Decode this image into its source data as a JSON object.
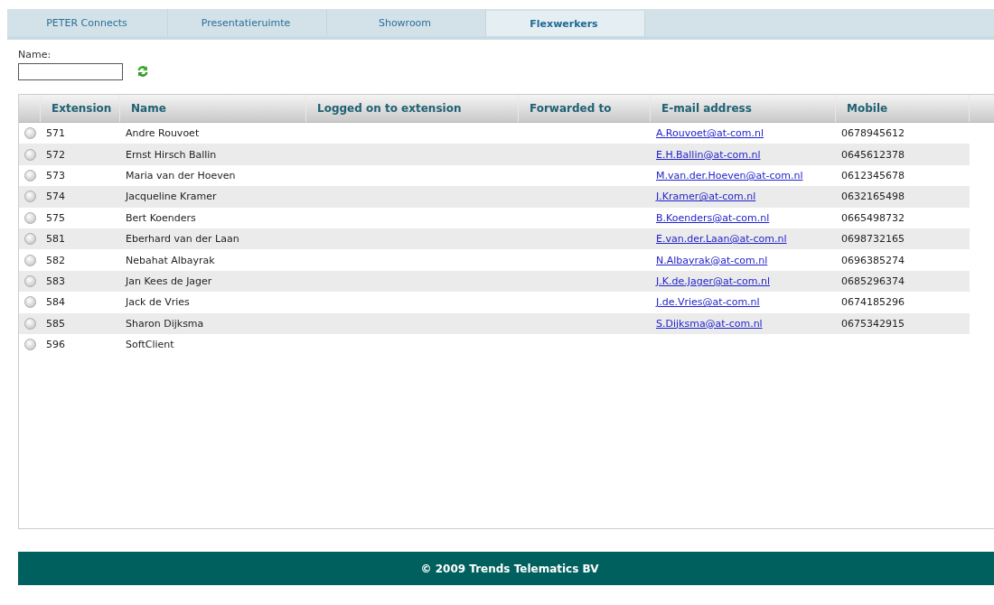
{
  "tabs": [
    {
      "label": "PETER Connects",
      "selected": false
    },
    {
      "label": "Presentatieruimte",
      "selected": false
    },
    {
      "label": "Showroom",
      "selected": false
    },
    {
      "label": "Flexwerkers",
      "selected": true
    }
  ],
  "filter": {
    "label": "Name:"
  },
  "table": {
    "columns": [
      "Extension",
      "Name",
      "Logged on to extension",
      "Forwarded to",
      "E-mail address",
      "Mobile"
    ],
    "rows": [
      {
        "selected": false,
        "extension": "571",
        "name": "Andre Rouvoet",
        "email": "A.Rouvoet@at-com.nl",
        "mobile": "0678945612"
      },
      {
        "selected": false,
        "extension": "572",
        "name": "Ernst Hirsch Ballin",
        "email": "E.H.Ballin@at-com.nl",
        "mobile": "0645612378"
      },
      {
        "selected": false,
        "extension": "573",
        "name": "Maria van der Hoeven",
        "email": "M.van.der.Hoeven@at-com.nl",
        "mobile": "0612345678"
      },
      {
        "selected": false,
        "extension": "574",
        "name": "Jacqueline Kramer",
        "email": "J.Kramer@at-com.nl",
        "mobile": "0632165498"
      },
      {
        "selected": false,
        "extension": "575",
        "name": "Bert Koenders",
        "email": "B.Koenders@at-com.nl",
        "mobile": "0665498732"
      },
      {
        "selected": false,
        "extension": "581",
        "name": "Eberhard van der Laan",
        "email": "E.van.der.Laan@at-com.nl",
        "mobile": "0698732165"
      },
      {
        "selected": false,
        "extension": "582",
        "name": "Nebahat Albayrak",
        "email": "N.Albayrak@at-com.nl",
        "mobile": "0696385274"
      },
      {
        "selected": false,
        "extension": "583",
        "name": "Jan Kees de Jager",
        "email": "J.K.de.Jager@at-com.nl",
        "mobile": "0685296374"
      },
      {
        "selected": false,
        "extension": "584",
        "name": "Jack de Vries",
        "email": "J.de.Vries@at-com.nl",
        "mobile": "0674185296"
      },
      {
        "selected": false,
        "extension": "585",
        "name": "Sharon Dijksma",
        "email": "S.Dijksma@at-com.nl",
        "mobile": "0675342915"
      },
      {
        "selected": false,
        "extension": "596",
        "name": "SoftClient"
      }
    ]
  },
  "footer": "© 2009 Trends Telematics BV"
}
